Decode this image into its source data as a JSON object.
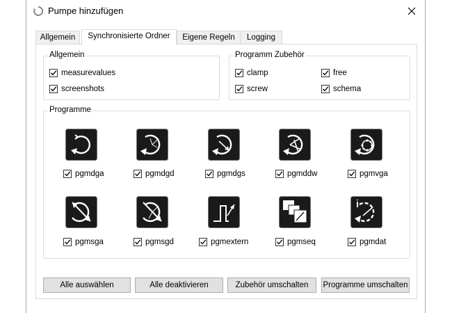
{
  "window": {
    "title": "Pumpe hinzufügen",
    "icons": {
      "app": "pump-icon",
      "close": "close-icon"
    }
  },
  "tabs": [
    {
      "label": "Allgemein",
      "active": false
    },
    {
      "label": "Synchronisierte Ordner",
      "active": true
    },
    {
      "label": "Eigene Regeln",
      "active": false
    },
    {
      "label": "Logging",
      "active": false
    }
  ],
  "groups": {
    "allgemein": {
      "label": "Allgemein",
      "items": [
        {
          "label": "measurevalues",
          "checked": true
        },
        {
          "label": "screenshots",
          "checked": true
        }
      ]
    },
    "zubehoer": {
      "label": "Programm Zubehör",
      "items": [
        {
          "label": "clamp",
          "checked": true
        },
        {
          "label": "free",
          "checked": true
        },
        {
          "label": "screw",
          "checked": true
        },
        {
          "label": "schema",
          "checked": true
        }
      ]
    },
    "programme": {
      "label": "Programme",
      "items": [
        {
          "label": "pgmdga",
          "checked": true,
          "icon": "pgmdga-icon"
        },
        {
          "label": "pgmdgd",
          "checked": true,
          "icon": "pgmdgd-icon"
        },
        {
          "label": "pgmdgs",
          "checked": true,
          "icon": "pgmdgs-icon"
        },
        {
          "label": "pgmddw",
          "checked": true,
          "icon": "pgmddw-icon"
        },
        {
          "label": "pgmvga",
          "checked": true,
          "icon": "pgmvga-icon"
        },
        {
          "label": "pgmsga",
          "checked": true,
          "icon": "pgmsga-icon"
        },
        {
          "label": "pgmsgd",
          "checked": true,
          "icon": "pgmsgd-icon"
        },
        {
          "label": "pgmextern",
          "checked": true,
          "icon": "pgmextern-icon"
        },
        {
          "label": "pgmseq",
          "checked": true,
          "icon": "pgmseq-icon"
        },
        {
          "label": "pgmdat",
          "checked": true,
          "icon": "pgmdat-icon"
        }
      ]
    }
  },
  "buttons": {
    "select_all": "Alle auswählen",
    "deactivate_all": "Alle deaktivieren",
    "toggle_accessories": "Zubehör umschalten",
    "toggle_programs": "Programme umschalten"
  },
  "colors": {
    "icon_fill": "#1a1a1a",
    "button_bg": "#e1e1e1",
    "border": "#d9d9d9"
  }
}
